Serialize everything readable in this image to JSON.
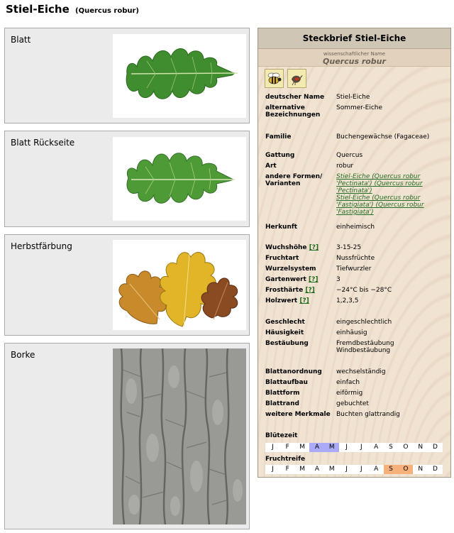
{
  "page": {
    "title": "Stiel-Eiche",
    "scientific_name": "(Quercus robur)"
  },
  "panels": [
    {
      "label": "Blatt",
      "image": "oak-leaf-top"
    },
    {
      "label": "Blatt Rückseite",
      "image": "oak-leaf-underside"
    },
    {
      "label": "Herbstfärbung",
      "image": "autumn-leaves"
    },
    {
      "label": "Borke",
      "image": "bark-texture"
    }
  ],
  "card": {
    "title": "Steckbrief Stiel-Eiche",
    "sci_label": "wissenschaftlicher Name",
    "sci_value": "Quercus robur",
    "icons": [
      "bee-icon",
      "bird-icon"
    ],
    "help_mark": "[?]",
    "rows": {
      "deutscher_name": {
        "k": "deutscher Name",
        "v": "Stiel-Eiche"
      },
      "alternative": {
        "k": "alternative Bezeichnungen",
        "v": "Sommer-Eiche"
      },
      "familie": {
        "k": "Familie",
        "v": "Buchengewächse (Fagaceae)"
      },
      "gattung": {
        "k": "Gattung",
        "v": "Quercus"
      },
      "art": {
        "k": "Art",
        "v": "robur"
      },
      "formen": {
        "k": "andere Formen/ Varianten",
        "v1": "Stiel-Eiche (Quercus robur 'Pectinata') (Quercus robur 'Pectinata')",
        "v2": "Stiel-Eiche (Quercus robur 'Fastigiata') (Quercus robur 'Fastigiata')"
      },
      "herkunft": {
        "k": "Herkunft",
        "v": "einheimisch"
      },
      "wuchshoehe": {
        "k": "Wuchshöhe",
        "v": "3-15-25"
      },
      "fruchtart": {
        "k": "Fruchtart",
        "v": "Nussfrüchte"
      },
      "wurzelsystem": {
        "k": "Wurzelsystem",
        "v": "Tiefwurzler"
      },
      "gartenwert": {
        "k": "Gartenwert",
        "v": "3"
      },
      "frosthaerte": {
        "k": "Frosthärte",
        "v": "−24°C bis −28°C"
      },
      "holzwert": {
        "k": "Holzwert",
        "v": "1,2,3,5"
      },
      "geschlecht": {
        "k": "Geschlecht",
        "v": "eingeschlechtlich"
      },
      "haeusigkeit": {
        "k": "Häusigkeit",
        "v": "einhäusig"
      },
      "bestaeubung": {
        "k": "Bestäubung",
        "v1": "Fremdbestäubung",
        "v2": "Windbestäubung"
      },
      "blattanordnung": {
        "k": "Blattanordnung",
        "v": "wechselständig"
      },
      "blattaufbau": {
        "k": "Blattaufbau",
        "v": "einfach"
      },
      "blattform": {
        "k": "Blattform",
        "v": "eiförmig"
      },
      "blattrand": {
        "k": "Blattrand",
        "v": "gebuchtet"
      },
      "merkmale": {
        "k": "weitere Merkmale",
        "v": "Buchten glattrandig"
      }
    },
    "bloom_label": "Blütezeit",
    "fruit_label": "Fruchtreife",
    "months": [
      "J",
      "F",
      "M",
      "A",
      "M",
      "J",
      "J",
      "A",
      "S",
      "O",
      "N",
      "D"
    ],
    "bloom_months": [
      4,
      5
    ],
    "fruit_months": [
      9,
      10
    ],
    "colors": {
      "bloom": "#aaaaf6",
      "fruit": "#f6b07a"
    }
  }
}
